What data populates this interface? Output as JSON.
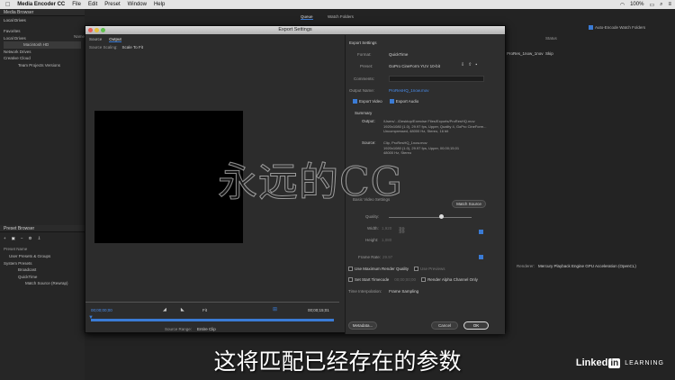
{
  "menubar": {
    "app": "Media Encoder CC",
    "items": [
      "File",
      "Edit",
      "Preset",
      "Window",
      "Help"
    ],
    "battery": "100%",
    "time": "Q"
  },
  "media_browser": {
    "title": "Media Browser",
    "location": "Local Drives",
    "col_name": "Name",
    "tree": [
      "Favorites",
      "Local Drives",
      "Macintosh HD",
      "Network Drives",
      "Creative Cloud",
      "Team Projects Versions"
    ]
  },
  "queue": {
    "tabs": [
      "Queue",
      "Watch Folders"
    ],
    "auto_encode": "Auto-Encode Watch Folders",
    "status_col": "Status",
    "queue_item": "ProRes_1now_1nov",
    "status": "Skip"
  },
  "preset_browser": {
    "title": "Preset Browser",
    "col_name": "Preset Name",
    "items": [
      "User Presets & Groups",
      "System Presets",
      "Broadcast",
      "QuickTime",
      "Match Source (Rewrap)"
    ]
  },
  "renderer": {
    "label": "Renderer:",
    "value": "Mercury Playback Engine GPU Acceleration (OpenCL)"
  },
  "export_dialog": {
    "title": "Export Settings",
    "tabs": [
      "Source",
      "Output"
    ],
    "source_scaling_label": "Source Scaling:",
    "source_scaling_value": "Scale To Fit",
    "timecode_in": "00;00;00;00",
    "timecode_out": "00;00;15;01",
    "fit": "Fit",
    "source_range_label": "Source Range:",
    "source_range_value": "Entire Clip",
    "export_settings_header": "Export Settings",
    "format_label": "Format:",
    "format_value": "QuickTime",
    "preset_label": "Preset:",
    "preset_value": "GoPro CineForm YUV 10-bit",
    "comments_label": "Comments:",
    "output_name_label": "Output Name:",
    "output_name_value": "ProResHQ_1now.mov",
    "export_video": "Export Video",
    "export_audio": "Export Audio",
    "summary_header": "Summary",
    "output_label": "Output:",
    "output_lines": [
      "/Users/.../Desktop/Exercise Files/Exports/ProResHQ.mov",
      "1920x1080 (1.0), 29.97 fps, Upper, Quality 4, GoPro CineForm...",
      "Uncompressed, 48000 Hz, Stereo, 16 bit"
    ],
    "source_label": "Source:",
    "source_lines": [
      "Clip, ProResHQ_1now.mov",
      "1920x1080 (1.0), 29.97 fps, Upper, 00;00;15;01",
      "48000 Hz, Stereo"
    ],
    "basic_video_label": "Basic Video Settings",
    "match_source": "Match Source",
    "quality_label": "Quality:",
    "width_label": "Width:",
    "width_value": "1,920",
    "height_label": "Height:",
    "height_value": "1,080",
    "frame_rate_label": "Frame Rate:",
    "frame_rate_value": "29.97",
    "use_max_render": "Use Maximum Render Quality",
    "use_previews": "Use Previews",
    "set_start_tc": "Set Start Timecode",
    "start_tc_value": "00;00;00;00",
    "render_alpha": "Render Alpha Channel Only",
    "time_interp_label": "Time Interpolation:",
    "time_interp_value": "Frame Sampling",
    "metadata_btn": "Metadata...",
    "cancel_btn": "Cancel",
    "ok_btn": "OK"
  },
  "watermark": "永远的CG",
  "subtitle": "这将匹配已经存在的参数",
  "branding": {
    "linked": "Linked",
    "in": "in",
    "learning": "LEARNING"
  }
}
